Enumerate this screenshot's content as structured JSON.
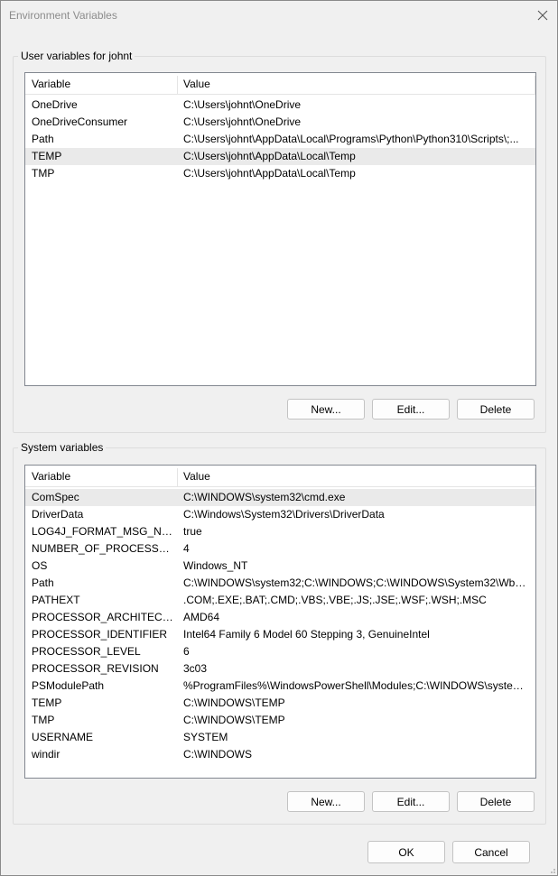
{
  "window": {
    "title": "Environment Variables",
    "close_icon": "close-icon"
  },
  "user_section": {
    "label": "User variables for johnt",
    "headers": {
      "variable": "Variable",
      "value": "Value"
    },
    "rows": [
      {
        "variable": "OneDrive",
        "value": "C:\\Users\\johnt\\OneDrive"
      },
      {
        "variable": "OneDriveConsumer",
        "value": "C:\\Users\\johnt\\OneDrive"
      },
      {
        "variable": "Path",
        "value": "C:\\Users\\johnt\\AppData\\Local\\Programs\\Python\\Python310\\Scripts\\;..."
      },
      {
        "variable": "TEMP",
        "value": "C:\\Users\\johnt\\AppData\\Local\\Temp",
        "selected": true
      },
      {
        "variable": "TMP",
        "value": "C:\\Users\\johnt\\AppData\\Local\\Temp"
      }
    ],
    "buttons": {
      "new": "New...",
      "edit": "Edit...",
      "delete": "Delete"
    }
  },
  "system_section": {
    "label": "System variables",
    "headers": {
      "variable": "Variable",
      "value": "Value"
    },
    "rows": [
      {
        "variable": "ComSpec",
        "value": "C:\\WINDOWS\\system32\\cmd.exe",
        "selected": true
      },
      {
        "variable": "DriverData",
        "value": "C:\\Windows\\System32\\Drivers\\DriverData"
      },
      {
        "variable": "LOG4J_FORMAT_MSG_NO_L...",
        "value": "true"
      },
      {
        "variable": "NUMBER_OF_PROCESSORS",
        "value": "4"
      },
      {
        "variable": "OS",
        "value": "Windows_NT"
      },
      {
        "variable": "Path",
        "value": "C:\\WINDOWS\\system32;C:\\WINDOWS;C:\\WINDOWS\\System32\\Wbem..."
      },
      {
        "variable": "PATHEXT",
        "value": ".COM;.EXE;.BAT;.CMD;.VBS;.VBE;.JS;.JSE;.WSF;.WSH;.MSC"
      },
      {
        "variable": "PROCESSOR_ARCHITECTURE",
        "value": "AMD64"
      },
      {
        "variable": "PROCESSOR_IDENTIFIER",
        "value": "Intel64 Family 6 Model 60 Stepping 3, GenuineIntel"
      },
      {
        "variable": "PROCESSOR_LEVEL",
        "value": "6"
      },
      {
        "variable": "PROCESSOR_REVISION",
        "value": "3c03"
      },
      {
        "variable": "PSModulePath",
        "value": "%ProgramFiles%\\WindowsPowerShell\\Modules;C:\\WINDOWS\\system..."
      },
      {
        "variable": "TEMP",
        "value": "C:\\WINDOWS\\TEMP"
      },
      {
        "variable": "TMP",
        "value": "C:\\WINDOWS\\TEMP"
      },
      {
        "variable": "USERNAME",
        "value": "SYSTEM"
      },
      {
        "variable": "windir",
        "value": "C:\\WINDOWS"
      }
    ],
    "buttons": {
      "new": "New...",
      "edit": "Edit...",
      "delete": "Delete"
    }
  },
  "footer": {
    "ok": "OK",
    "cancel": "Cancel"
  },
  "colors": {
    "selected_row": "#eaeaea",
    "background": "#f0f0f0",
    "list_border": "#828790"
  }
}
